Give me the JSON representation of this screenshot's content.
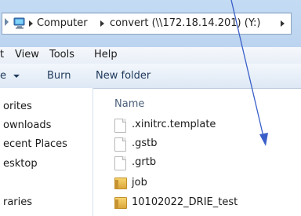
{
  "address_bar": {
    "crumbs": [
      "Computer",
      "convert (\\\\172.18.14.201) (Y:)"
    ],
    "icon": "computer-icon"
  },
  "menu": {
    "items": [
      "t",
      "View",
      "Tools",
      "Help"
    ]
  },
  "toolbar": {
    "organize_label": "e",
    "burn_label": "Burn",
    "new_folder_label": "New folder"
  },
  "nav": {
    "items": [
      "orites",
      "ownloads",
      "ecent Places",
      "esktop",
      "raries"
    ]
  },
  "content": {
    "column_name": "Name",
    "files": [
      {
        "name": ".xinitrc.template",
        "type": "file"
      },
      {
        "name": ".gstb",
        "type": "file"
      },
      {
        "name": ".grtb",
        "type": "file"
      },
      {
        "name": "job",
        "type": "folder"
      },
      {
        "name": "10102022_DRIE_test",
        "type": "folder"
      }
    ]
  },
  "colors": {
    "annotation_arrow": "#3a5fc8",
    "title_gradient": "#c4dbf4"
  }
}
